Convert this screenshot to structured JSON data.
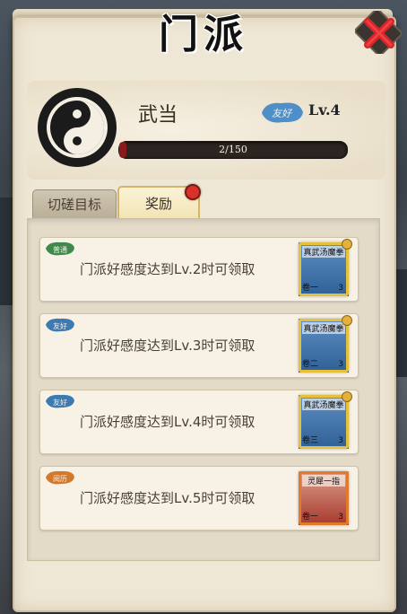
{
  "title": "门派",
  "sect": {
    "name": "武当",
    "relation_badge": "友好",
    "level": "Lv.4",
    "progress_text": "2/150",
    "progress_fraction": 0.013
  },
  "tabs": [
    {
      "label": "切磋目标",
      "active": false
    },
    {
      "label": "奖励",
      "active": true
    }
  ],
  "rewards": [
    {
      "badge": "普通",
      "badge_color": "#3f8a4a",
      "text": "门派好感度达到Lv.2时可领取",
      "item": {
        "name": "真武汤魔拳",
        "volume": "卷一",
        "qty": "3",
        "frame": "gold"
      }
    },
    {
      "badge": "友好",
      "badge_color": "#3d7ab0",
      "text": "门派好感度达到Lv.3时可领取",
      "item": {
        "name": "真武汤魔拳",
        "volume": "卷二",
        "qty": "3",
        "frame": "gold"
      }
    },
    {
      "badge": "友好",
      "badge_color": "#3d7ab0",
      "text": "门派好感度达到Lv.4时可领取",
      "item": {
        "name": "真武汤魔拳",
        "volume": "卷三",
        "qty": "3",
        "frame": "gold"
      }
    },
    {
      "badge": "阅历",
      "badge_color": "#d17a2e",
      "text": "门派好感度达到Lv.5时可领取",
      "item": {
        "name": "灵犀一指",
        "volume": "卷一",
        "qty": "3",
        "frame": "orange"
      }
    }
  ]
}
